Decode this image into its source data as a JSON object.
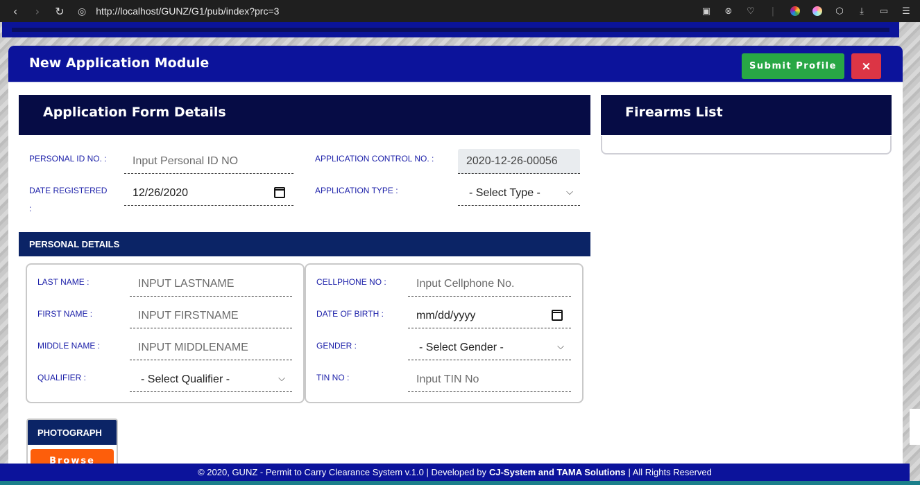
{
  "browser": {
    "url": "http://localhost/GUNZ/G1/pub/index?prc=3",
    "back_icon": "chevron-left-icon",
    "forward_icon": "chevron-right-icon",
    "reload_icon": "reload-icon"
  },
  "modal": {
    "title": "New Application Module",
    "submit_label": "Submit Profile",
    "close_label": "×"
  },
  "application_form": {
    "header": "Application Form Details",
    "personal_id": {
      "label": "PERSONAL ID NO. :",
      "placeholder": "Input Personal ID NO"
    },
    "control_no": {
      "label": "APPLICATION CONTROL NO. :",
      "value": "2020-12-26-00056"
    },
    "date_registered": {
      "label": "DATE REGISTERED",
      "label_suffix": ":",
      "value": "12/26/2020"
    },
    "application_type": {
      "label": "APPLICATION TYPE :",
      "value": "- Select Type -"
    }
  },
  "firearms": {
    "header": "Firearms List"
  },
  "personal_details": {
    "header": "PERSONAL DETAILS",
    "last_name": {
      "label": "LAST NAME :",
      "placeholder": "INPUT LASTNAME"
    },
    "first_name": {
      "label": "FIRST NAME :",
      "placeholder": "INPUT FIRSTNAME"
    },
    "middle_name": {
      "label": "MIDDLE NAME :",
      "placeholder": "INPUT MIDDLENAME"
    },
    "qualifier": {
      "label": "QUALIFIER :",
      "value": "- Select Qualifier -"
    },
    "cellphone": {
      "label": "CELLPHONE NO :",
      "placeholder": "Input Cellphone No."
    },
    "dob": {
      "label": "DATE OF BIRTH :",
      "value": "mm/dd/yyyy"
    },
    "gender": {
      "label": "GENDER :",
      "value": "- Select Gender -"
    },
    "tin": {
      "label": "TIN NO :",
      "placeholder": "Input TIN No"
    }
  },
  "photograph": {
    "header": "PHOTOGRAPH",
    "browse_label": "Browse"
  },
  "footer": {
    "prefix": "© 2020, GUNZ - Permit to Carry Clearance System v.1.0 | Developed by",
    "developer": "CJ-System and TAMA Solutions",
    "suffix": "| All Rights Reserved"
  },
  "colors": {
    "brand_blue": "#0c139b",
    "dark_navy": "#060c45",
    "success": "#28a745",
    "danger": "#dc3545",
    "orange": "#fd5e0b"
  }
}
